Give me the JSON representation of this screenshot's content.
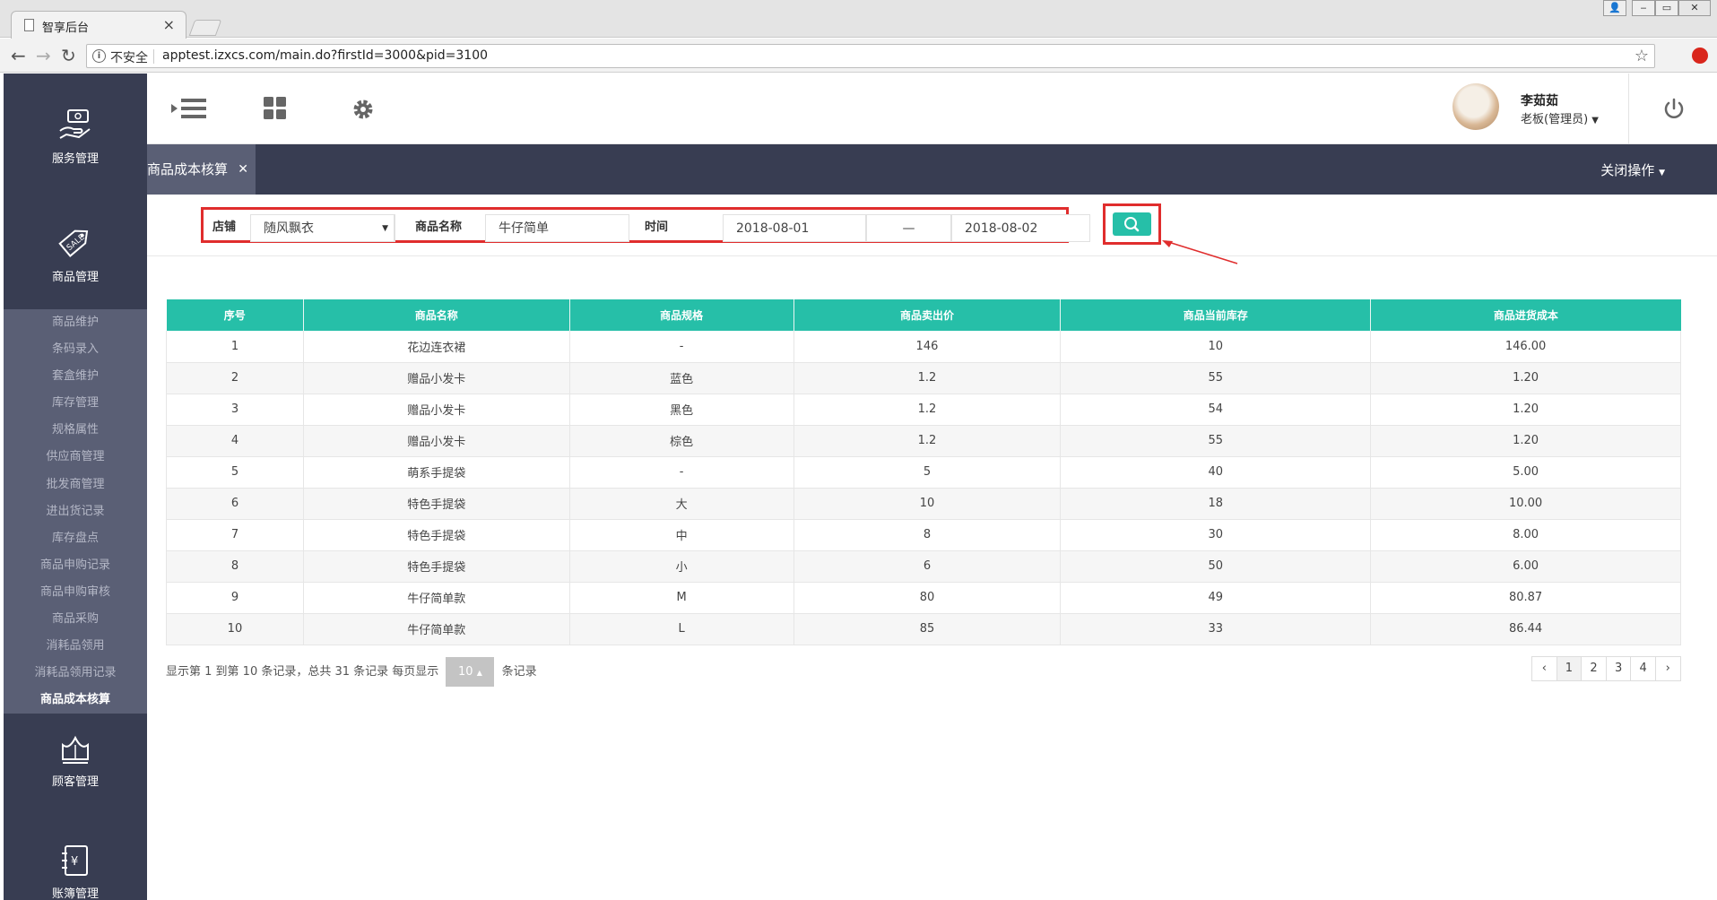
{
  "browser": {
    "tab_title": "智享后台",
    "insecure_label": "不安全",
    "url": "apptest.izxcs.com/main.do?firstId=3000&pid=3100"
  },
  "sidebar": {
    "modules": [
      {
        "label": "服务管理",
        "icon": "hand-money-icon"
      },
      {
        "label": "商品管理",
        "icon": "sale-tag-icon"
      },
      {
        "label": "顾客管理",
        "icon": "crown-icon"
      },
      {
        "label": "账簿管理",
        "icon": "ledger-icon"
      }
    ],
    "submenu": [
      "商品维护",
      "条码录入",
      "套盒维护",
      "库存管理",
      "规格属性",
      "供应商管理",
      "批发商管理",
      "进出货记录",
      "库存盘点",
      "商品申购记录",
      "商品申购审核",
      "商品采购",
      "消耗品领用",
      "消耗品领用记录",
      "商品成本核算"
    ],
    "active_item": "商品成本核算"
  },
  "header": {
    "user_name": "李茹茹",
    "user_role": "老板(管理员)"
  },
  "tabs": {
    "current": "商品成本核算",
    "close_ops": "关闭操作"
  },
  "filter": {
    "store_label": "店铺",
    "store_value": "随风飘衣",
    "product_label": "商品名称",
    "product_value": "牛仔简单",
    "time_label": "时间",
    "date_from": "2018-08-01",
    "date_sep": "—",
    "date_to": "2018-08-02"
  },
  "table": {
    "columns": [
      "序号",
      "商品名称",
      "商品规格",
      "商品卖出价",
      "商品当前库存",
      "商品进货成本"
    ],
    "rows": [
      [
        "1",
        "花边连衣裙",
        "-",
        "146",
        "10",
        "146.00"
      ],
      [
        "2",
        "赠品小发卡",
        "蓝色",
        "1.2",
        "55",
        "1.20"
      ],
      [
        "3",
        "赠品小发卡",
        "黑色",
        "1.2",
        "54",
        "1.20"
      ],
      [
        "4",
        "赠品小发卡",
        "棕色",
        "1.2",
        "55",
        "1.20"
      ],
      [
        "5",
        "萌系手提袋",
        "-",
        "5",
        "40",
        "5.00"
      ],
      [
        "6",
        "特色手提袋",
        "大",
        "10",
        "18",
        "10.00"
      ],
      [
        "7",
        "特色手提袋",
        "中",
        "8",
        "30",
        "8.00"
      ],
      [
        "8",
        "特色手提袋",
        "小",
        "6",
        "50",
        "6.00"
      ],
      [
        "9",
        "牛仔简单款",
        "M",
        "80",
        "49",
        "80.87"
      ],
      [
        "10",
        "牛仔简单款",
        "L",
        "85",
        "33",
        "86.44"
      ]
    ]
  },
  "pagination": {
    "info_prefix": "显示第 1 到第 10 条记录，总共 31 条记录 每页显示",
    "page_size": "10",
    "info_suffix": "条记录",
    "pages": [
      "‹",
      "1",
      "2",
      "3",
      "4",
      "›"
    ]
  },
  "colors": {
    "accent": "#26bfa8",
    "sidebar": "#383d52",
    "highlight": "#e02d2d"
  }
}
